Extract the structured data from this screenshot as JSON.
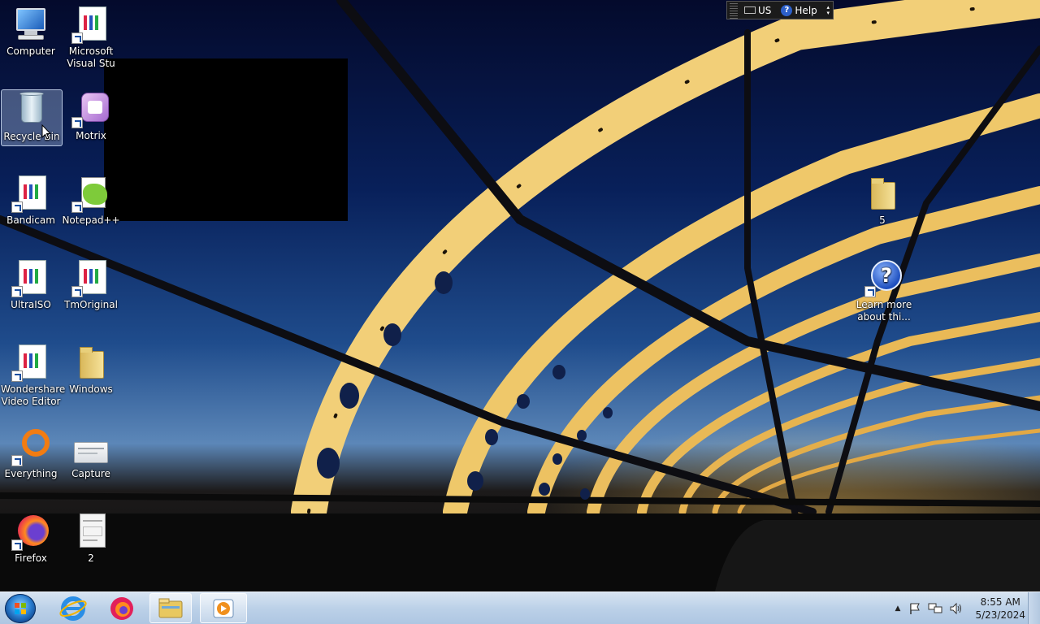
{
  "desktop": {
    "icons": [
      {
        "label": "Computer",
        "icon": "computer-icon"
      },
      {
        "label": "Microsoft Visual Stu",
        "icon": "visual-studio-icon"
      },
      {
        "label": "Recycle Bin",
        "icon": "recycle-bin-icon"
      },
      {
        "label": "Motrix",
        "icon": "motrix-icon"
      },
      {
        "label": "Bandicam",
        "icon": "bandicam-icon"
      },
      {
        "label": "Notepad++",
        "icon": "notepadpp-icon"
      },
      {
        "label": "UltraISO",
        "icon": "ultraiso-icon"
      },
      {
        "label": "TmOriginal",
        "icon": "tmoriginal-icon"
      },
      {
        "label": "Wondershare Video Editor",
        "icon": "wondershare-icon"
      },
      {
        "label": "Windows",
        "icon": "folder-icon"
      },
      {
        "label": "Everything",
        "icon": "everything-icon"
      },
      {
        "label": "Capture",
        "icon": "capture-icon"
      },
      {
        "label": "Firefox",
        "icon": "firefox-icon"
      },
      {
        "label": "2",
        "icon": "document-icon"
      },
      {
        "label": "5",
        "icon": "folder-icon"
      },
      {
        "label": "Learn more about thi...",
        "icon": "help-icon"
      }
    ]
  },
  "language_bar": {
    "language": "US",
    "help_label": "Help"
  },
  "taskbar": {
    "pinned": [
      "start-orb",
      "internet-explorer-icon",
      "firefox-icon",
      "windows-explorer-icon",
      "media-player-icon"
    ],
    "clock": {
      "time": "8:55 AM",
      "date": "5/23/2024"
    }
  },
  "colors": {
    "taskbar": "#bcd1e8",
    "sky_top": "#040a2c",
    "bridge": "#f0c860"
  }
}
